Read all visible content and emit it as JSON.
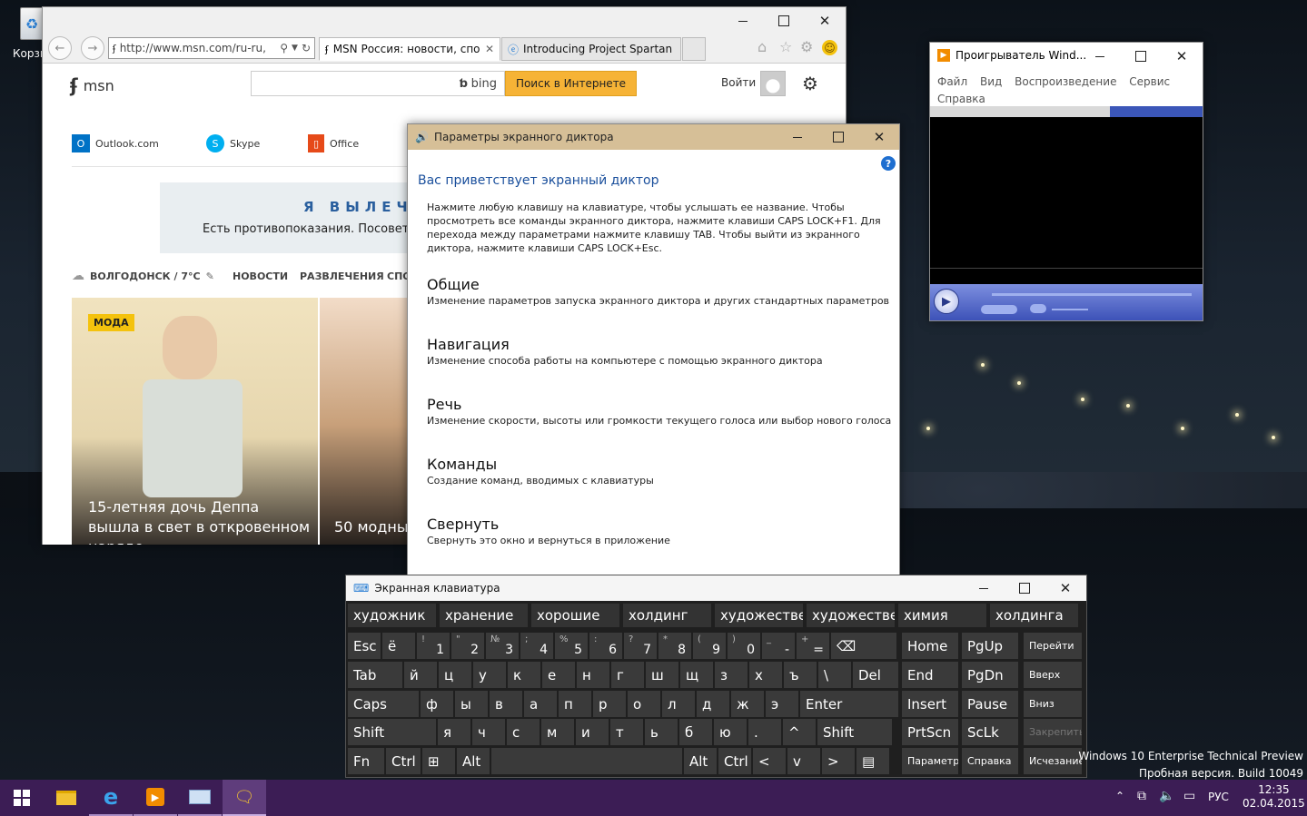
{
  "desktop": {
    "recycle_bin_label": "Корзи",
    "watermark_line1": "Windows 10 Enterprise Technical Preview",
    "watermark_line2": "Пробная версия. Build 10049"
  },
  "ie": {
    "address": "http://www.msn.com/ru-ru,",
    "tabs": [
      {
        "label": "MSN Россия: новости, спо..."
      },
      {
        "label": "Introducing Project Spartan on..."
      }
    ],
    "msn": {
      "logo_text": "msn",
      "search_placeholder": "",
      "bing_label": "bing",
      "search_button": "Поиск в Интернете",
      "signin": "Войти",
      "links": [
        {
          "label": "Outlook.com"
        },
        {
          "label": "Skype"
        },
        {
          "label": "Office"
        }
      ],
      "ad_title": "Я ВЫЛЕЧ",
      "ad_text": "Есть противопоказания. Посовету",
      "weather": "ВОЛГОДОНСК / 7°C",
      "nav": [
        "НОВОСТИ",
        "РАЗВЛЕЧЕНИЯ",
        "СПО"
      ],
      "cards": [
        {
          "badge": "МОДА",
          "title": "15-летняя дочь Деппа вышла в свет в откровенном наряде"
        },
        {
          "title": "50 модных"
        }
      ]
    }
  },
  "narrator": {
    "title": "Параметры экранного диктора",
    "heading": "Вас приветствует экранный диктор",
    "intro": "Нажмите любую клавишу на клавиатуре, чтобы услышать ее название. Чтобы просмотреть все команды экранного диктора, нажмите клавиши CAPS LOCK+F1. Для перехода между параметрами нажмите клавишу TAB. Чтобы выйти из экранного диктора, нажмите клавиши CAPS LOCK+Esc.",
    "sections": [
      {
        "title": "Общие",
        "desc": "Изменение параметров запуска экранного диктора и других стандартных параметров"
      },
      {
        "title": "Навигация",
        "desc": "Изменение способа работы на компьютере с помощью экранного диктора"
      },
      {
        "title": "Речь",
        "desc": "Изменение скорости, высоты или громкости текущего голоса или выбор нового голоса"
      },
      {
        "title": "Команды",
        "desc": "Создание команд, вводимых с клавиатуры"
      },
      {
        "title": "Свернуть",
        "desc": "Свернуть это окно и вернуться в приложение"
      }
    ]
  },
  "media_player": {
    "title": "Проигрыватель Wind...",
    "menu": [
      "Файл",
      "Вид",
      "Воспроизведение",
      "Сервис",
      "Справка"
    ]
  },
  "osk": {
    "title": "Экранная клавиатура",
    "suggestions": [
      "художник",
      "хранение",
      "хорошие",
      "холдинг",
      "художестве...",
      "художестве...",
      "химия",
      "холдинга"
    ],
    "row1": [
      {
        "main": "Esc"
      },
      {
        "main": "ё"
      },
      {
        "main": "1",
        "sup": "!"
      },
      {
        "main": "2",
        "sup": "\""
      },
      {
        "main": "3",
        "sup": "№"
      },
      {
        "main": "4",
        "sup": ";"
      },
      {
        "main": "5",
        "sup": "%"
      },
      {
        "main": "6",
        "sup": ":"
      },
      {
        "main": "7",
        "sup": "?"
      },
      {
        "main": "8",
        "sup": "*"
      },
      {
        "main": "9",
        "sup": "("
      },
      {
        "main": "0",
        "sup": ")"
      },
      {
        "main": "-",
        "sup": "_"
      },
      {
        "main": "=",
        "sup": "+"
      },
      {
        "main": "⌫"
      }
    ],
    "row2": [
      "Tab",
      "й",
      "ц",
      "у",
      "к",
      "е",
      "н",
      "г",
      "ш",
      "щ",
      "з",
      "х",
      "ъ",
      "\\",
      "Del"
    ],
    "row3": [
      "Caps",
      "ф",
      "ы",
      "в",
      "а",
      "п",
      "р",
      "о",
      "л",
      "д",
      "ж",
      "э",
      "Enter"
    ],
    "row4": [
      "Shift",
      "я",
      "ч",
      "с",
      "м",
      "и",
      "т",
      "ь",
      "б",
      "ю",
      ".",
      "^",
      "Shift"
    ],
    "row5": [
      "Fn",
      "Ctrl",
      "⊞",
      "Alt",
      "",
      "Alt",
      "Ctrl",
      "<",
      "v",
      ">",
      "▤"
    ],
    "nav_keys": [
      [
        "Home",
        "PgUp",
        "Перейти"
      ],
      [
        "End",
        "PgDn",
        "Вверх"
      ],
      [
        "Insert",
        "Pause",
        "Вниз"
      ],
      [
        "PrtScn",
        "ScLk",
        "Закрепить"
      ],
      [
        "Параметры",
        "Справка",
        "Исчезание"
      ]
    ]
  },
  "taskbar": {
    "lang": "РУС",
    "time": "12:35",
    "date": "02.04.2015"
  }
}
